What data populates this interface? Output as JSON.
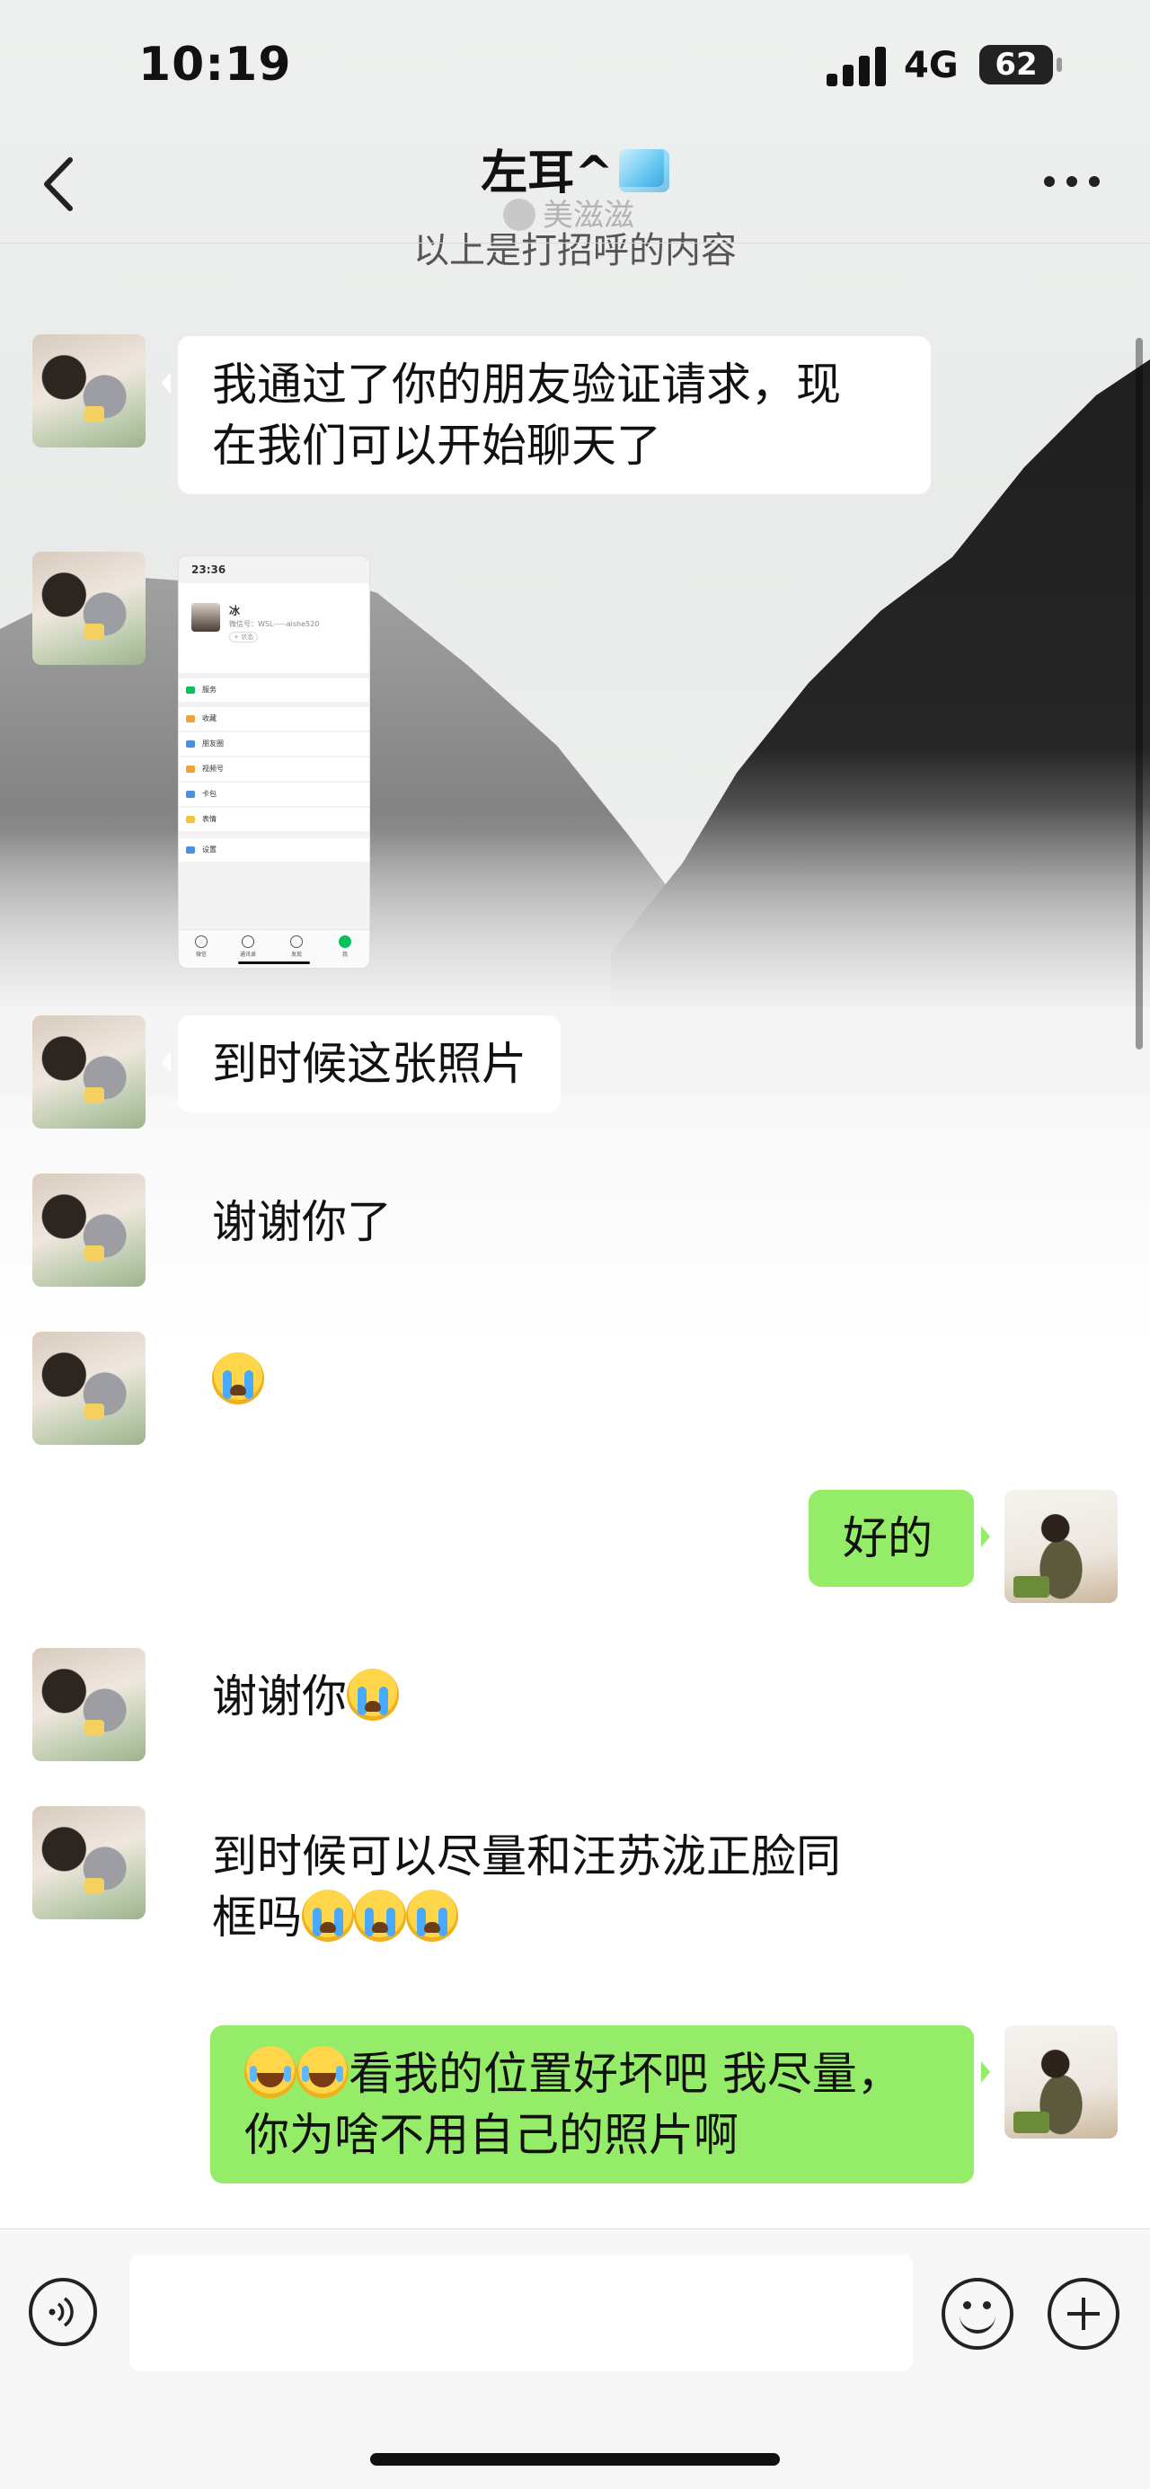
{
  "status_bar": {
    "time": "10:19",
    "network": "4G",
    "battery": "62"
  },
  "nav": {
    "title": "左耳^",
    "watermark": "美滋滋"
  },
  "system_note": "以上是打招呼的内容",
  "screenshot": {
    "time": "23:36",
    "name": "冰",
    "wechat_id": "微信号：WSL-----aishe520",
    "state": "+ 状态",
    "rows": [
      "服务",
      "收藏",
      "朋友圈",
      "视频号",
      "卡包",
      "表情",
      "设置"
    ],
    "tabs": [
      "微信",
      "通讯录",
      "发现",
      "我"
    ]
  },
  "messages": [
    {
      "side": "left",
      "text": "我通过了你的朋友验证请求，现\n在我们可以开始聊天了"
    },
    {
      "side": "left",
      "text": "到时候这张照片"
    },
    {
      "side": "left",
      "text": "谢谢你了"
    },
    {
      "side": "right",
      "text": "好的"
    },
    {
      "side": "left",
      "text": "谢谢你"
    },
    {
      "side": "left",
      "text": "到时候可以尽量和汪苏泷正脸同\n框吗"
    },
    {
      "side": "right",
      "text": "看我的位置好坏吧 我尽量，\n你为啥不用自己的照片啊"
    }
  ],
  "input": {
    "value": "",
    "placeholder": ""
  },
  "colors": {
    "sent_bubble": "#95ec69",
    "received_bubble": "#ffffff",
    "background": "#f1f1f1"
  }
}
